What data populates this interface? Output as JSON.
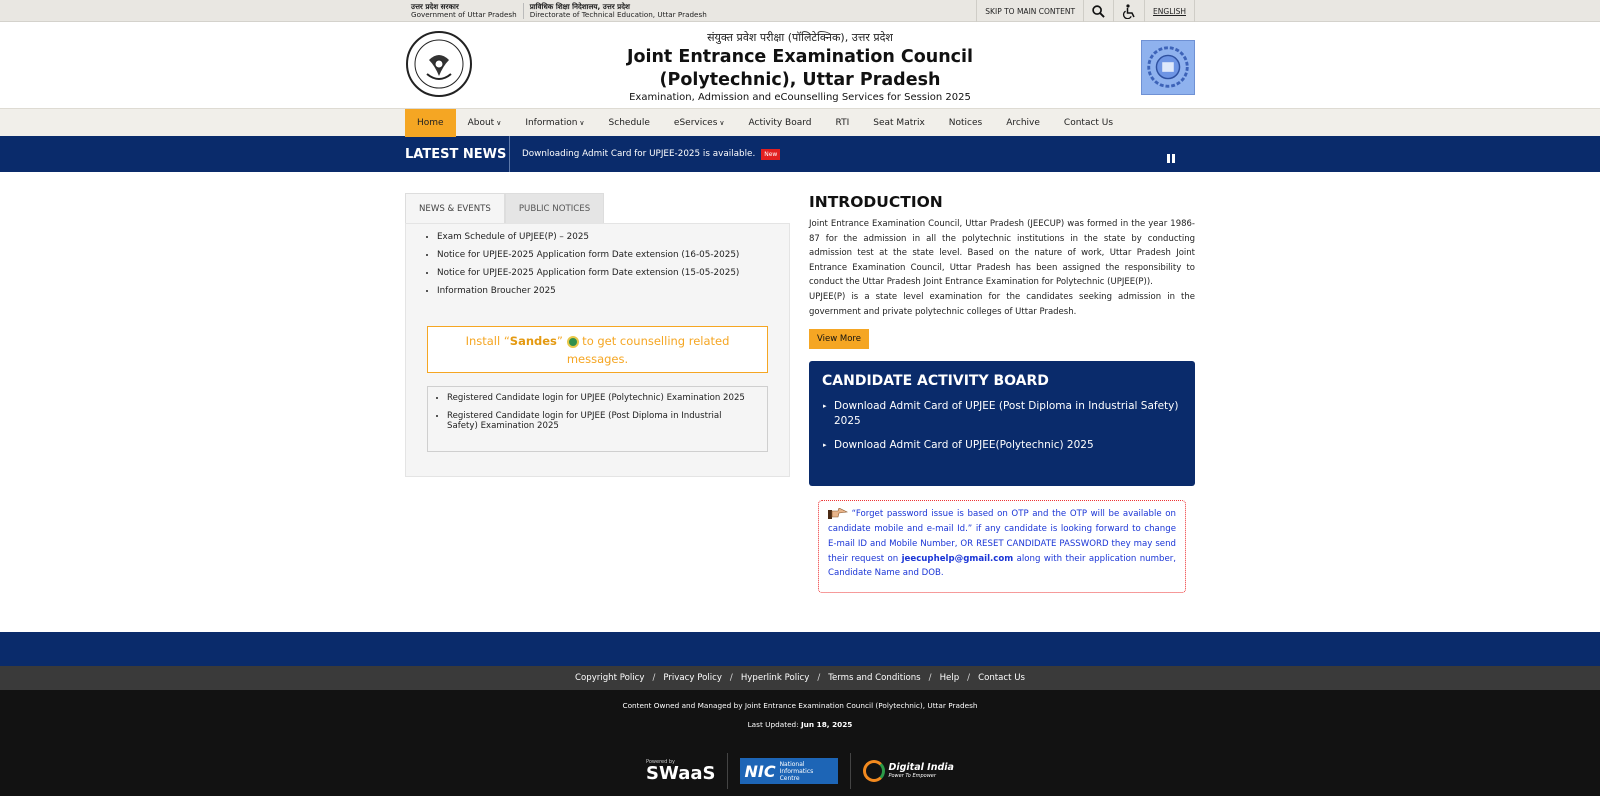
{
  "topbar": {
    "gov_hindi": "उत्तर प्रदेश सरकार",
    "gov_english": "Government of Uttar Pradesh",
    "dte_hindi": "प्राविधिक शिक्षा निदेशालय, उत्तर प्रदेश",
    "dte_english": "Directorate of Technical Education, Uttar Pradesh",
    "skip": "SKIP TO MAIN CONTENT",
    "language": "ENGLISH"
  },
  "header": {
    "hindi_title": "संयुक्त प्रवेश परीक्षा (पॉलिटेक्निक), उत्तर प्रदेश",
    "title_line1": "Joint Entrance Examination Council",
    "title_line2": "(Polytechnic), Uttar Pradesh",
    "subtitle": "Examination, Admission and eCounselling Services for Session 2025"
  },
  "nav": {
    "items": [
      {
        "label": "Home",
        "active": true,
        "dropdown": false
      },
      {
        "label": "About",
        "active": false,
        "dropdown": true
      },
      {
        "label": "Information",
        "active": false,
        "dropdown": true
      },
      {
        "label": "Schedule",
        "active": false,
        "dropdown": false
      },
      {
        "label": "eServices",
        "active": false,
        "dropdown": true
      },
      {
        "label": "Activity Board",
        "active": false,
        "dropdown": false
      },
      {
        "label": "RTI",
        "active": false,
        "dropdown": false
      },
      {
        "label": "Seat Matrix",
        "active": false,
        "dropdown": false
      },
      {
        "label": "Notices",
        "active": false,
        "dropdown": false
      },
      {
        "label": "Archive",
        "active": false,
        "dropdown": false
      },
      {
        "label": "Contact Us",
        "active": false,
        "dropdown": false
      }
    ]
  },
  "latest_news": {
    "label": "LATEST NEWS",
    "text": "Downloading Admit Card for UPJEE-2025 is available.",
    "badge": "New",
    "pause_icon": "pause-icon"
  },
  "left": {
    "tabs": [
      "NEWS & EVENTS",
      "PUBLIC NOTICES"
    ],
    "notices": [
      "Exam Schedule of UPJEE(P) – 2025",
      "Notice for UPJEE-2025 Application form Date extension (16-05-2025)",
      "Notice for UPJEE-2025 Application form Date extension (15-05-2025)",
      "Information Broucher 2025"
    ],
    "sandes_pre": "Install “",
    "sandes_name": "Sandes",
    "sandes_mid": "” ",
    "sandes_post": " to get counselling related messages.",
    "logins": [
      "Registered Candidate login for UPJEE (Polytechnic) Examination 2025",
      "Registered Candidate login for UPJEE (Post Diploma in Industrial Safety) Examination 2025"
    ]
  },
  "right": {
    "intro_heading": "INTRODUCTION",
    "intro_p1": "Joint Entrance Examination Council, Uttar Pradesh (JEECUP) was formed in the year 1986-87 for the admission in all the polytechnic institutions in the state by conducting admission test at the state level. Based on the nature of work, Uttar Pradesh Joint Entrance Examination Council, Uttar Pradesh has been assigned the responsibility to conduct the Uttar Pradesh Joint Entrance Examination for Polytechnic (UPJEE(P)).",
    "intro_p2": "UPJEE(P) is a state level examination for the candidates seeking admission in the government and private polytechnic colleges of Uttar Pradesh.",
    "view_more": "View More",
    "cab_heading": "CANDIDATE ACTIVITY BOARD",
    "cab_links": [
      "Download Admit Card of UPJEE (Post Diploma in Industrial Safety) 2025",
      "Download Admit Card of UPJEE(Polytechnic) 2025"
    ],
    "notice_pre": " “Forget password issue is based on OTP and the OTP will be available on candidate mobile and e-mail Id.” if any candidate is looking forward to change E-mail ID and Mobile Number, OR RESET CANDIDATE PASSWORD they may send their request on ",
    "notice_email": "jeecuphelp@gmail.com",
    "notice_post": " along with their application number, Candidate Name and DOB."
  },
  "footer": {
    "links": [
      "Copyright Policy",
      "Privacy Policy",
      "Hyperlink Policy",
      "Terms and Conditions",
      "Help",
      "Contact Us"
    ],
    "separator": "/",
    "owned": "Content Owned and Managed by Joint Entrance Examination Council (Polytechnic), Uttar Pradesh",
    "updated_label": "Last Updated: ",
    "updated_date": "Jun 18, 2025",
    "swaas_powered": "Powered by",
    "swaas_name": "SWaaS",
    "nic_big": "NIC",
    "nic_line1": "National",
    "nic_line2": "Informatics",
    "nic_line3": "Centre",
    "di_name": "Digital India",
    "di_tag": "Power To Empower"
  },
  "colors": {
    "navy": "#0a2b6b",
    "accent": "#f5a623",
    "new_badge": "#e21f1f",
    "notice_text": "#1a35d6"
  }
}
